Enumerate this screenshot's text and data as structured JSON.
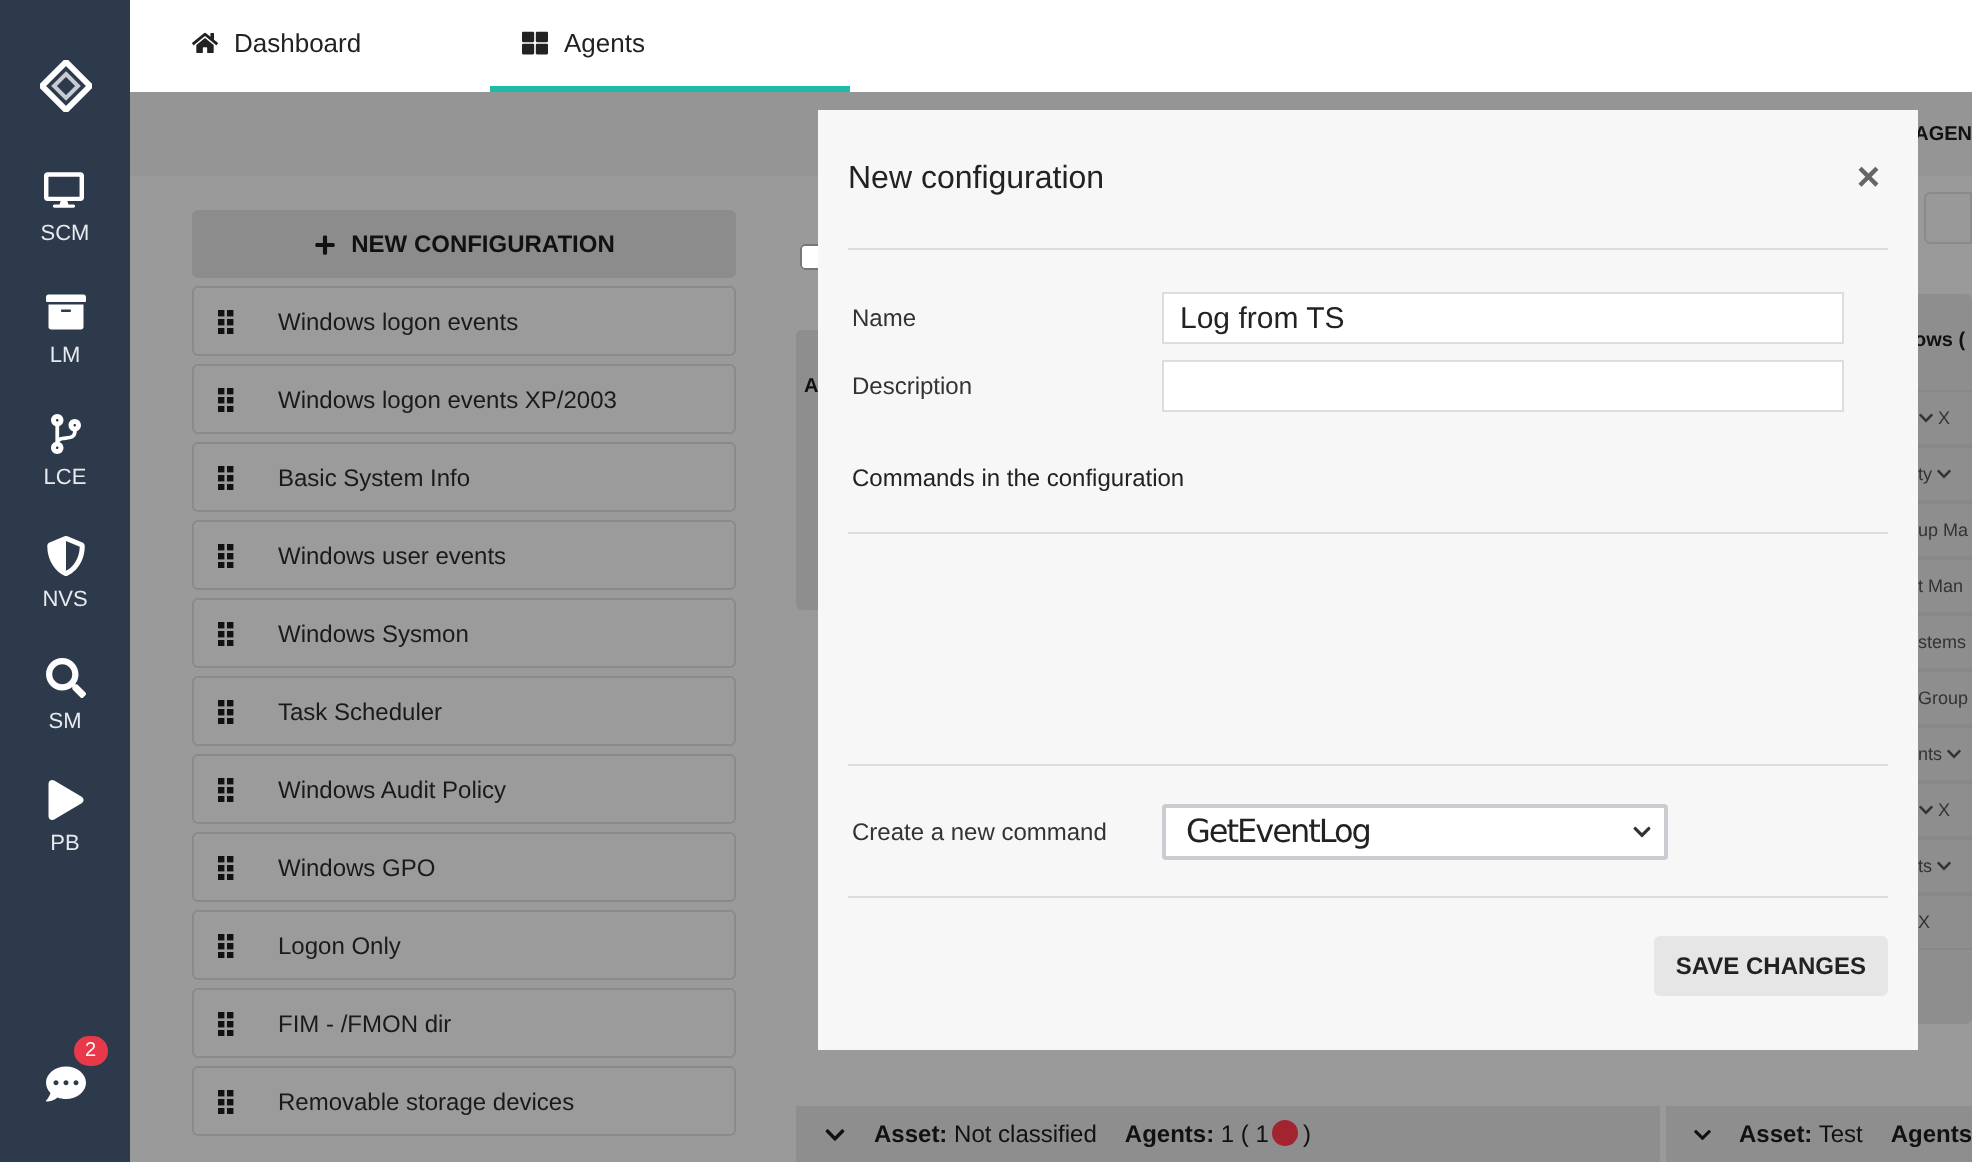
{
  "sidebar": {
    "items": [
      {
        "label": "SCM"
      },
      {
        "label": "LM"
      },
      {
        "label": "LCE"
      },
      {
        "label": "NVS"
      },
      {
        "label": "SM"
      },
      {
        "label": "PB"
      }
    ],
    "chat_badge": "2"
  },
  "tabs": [
    {
      "label": "Dashboard",
      "selected": false
    },
    {
      "label": "Agents",
      "selected": true
    }
  ],
  "header_fragment": "AGEN",
  "new_configuration_button": "NEW CONFIGURATION",
  "configurations": [
    "Windows logon events",
    "Windows logon events XP/2003",
    "Basic System Info",
    "Windows user events",
    "Windows Sysmon",
    "Task Scheduler",
    "Windows Audit Policy",
    "Windows GPO",
    "Logon Only",
    "FIM - /FMON dir",
    "Removable storage devices"
  ],
  "filter_checkbox": {
    "checked": false
  },
  "middle_card_fragment": "A",
  "right_card": {
    "title_fragment": "ows (",
    "rows": [
      {
        "text": "X",
        "kind": "leading"
      },
      {
        "text": "ty",
        "kind": "trailing"
      },
      {
        "text": "up Ma",
        "kind": "plain"
      },
      {
        "text": "t Man",
        "kind": "plain"
      },
      {
        "text": "stems",
        "kind": "plain"
      },
      {
        "text": "Group",
        "kind": "plain"
      },
      {
        "text": "nts",
        "kind": "trailing"
      },
      {
        "text": "X",
        "kind": "leading"
      },
      {
        "text": "ts",
        "kind": "trailing"
      },
      {
        "text": "X",
        "kind": "plain"
      }
    ]
  },
  "asset_bars": [
    {
      "asset_label": "Asset:",
      "asset": "Not classified",
      "agents_label": "Agents:",
      "agents": "1 ( 1",
      "color": "#a3242f",
      "agents_close": ")"
    },
    {
      "asset_label": "Asset:",
      "asset": "Test",
      "agents_label": "Agents"
    }
  ],
  "dialog": {
    "title": "New configuration",
    "close": "×",
    "fields": [
      {
        "label": "Name",
        "value": "Log from TS"
      },
      {
        "label": "Description"
      }
    ],
    "commands_heading": "Commands in the configuration",
    "new_command": {
      "label": "Create a new command",
      "value": "GetEventLog"
    },
    "save_button": "SAVE CHANGES"
  }
}
